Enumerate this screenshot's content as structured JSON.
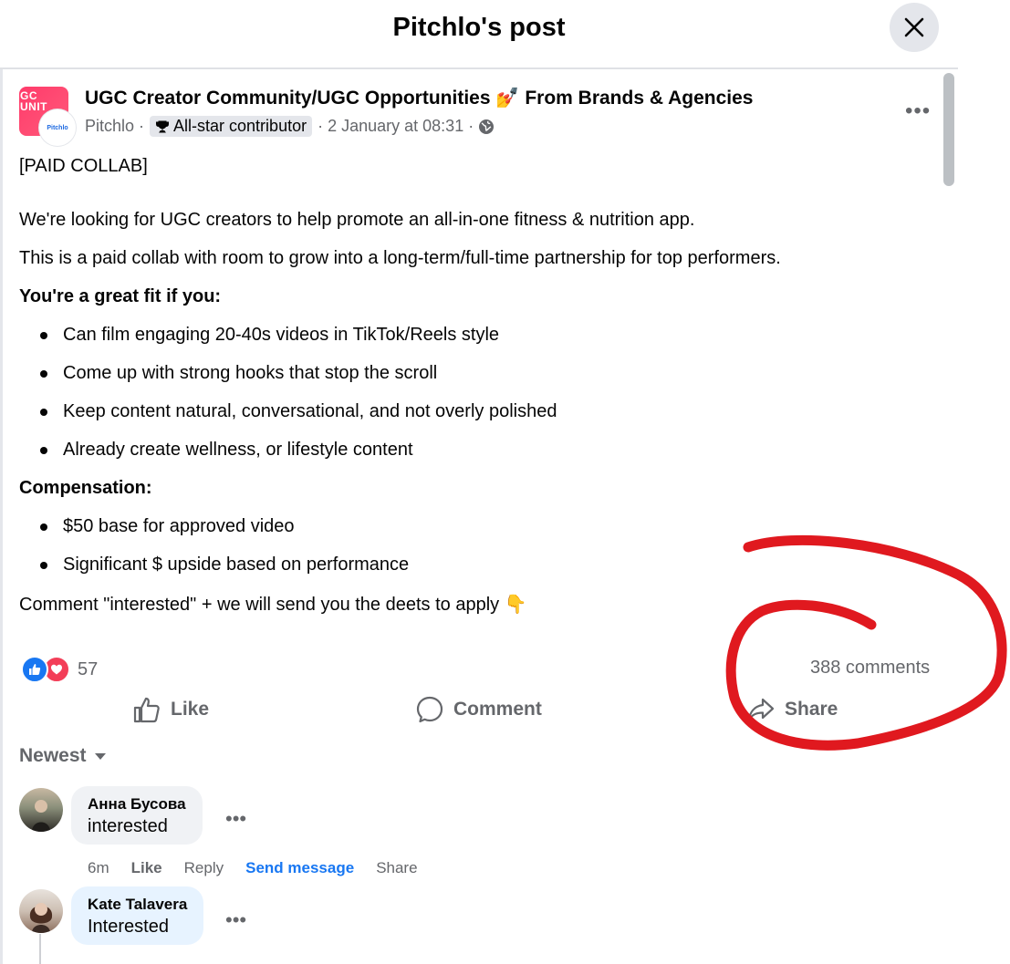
{
  "header": {
    "title": "Pitchlo's post"
  },
  "post": {
    "group_name": "UGC Creator Community/UGC Opportunities 💅 From Brands & Agencies",
    "group_avatar_text": "GC\nUNIT",
    "user_avatar_text": "Pitchlo",
    "author": "Pitchlo",
    "badge": "All-star contributor",
    "timestamp": "2 January at 08:31",
    "lines": [
      "[PAID COLLAB]",
      "We're looking for UGC creators to help promote an all-in-one fitness & nutrition app.",
      "This is a paid collab with room to grow into a long-term/full-time partnership for top performers.",
      "You're a great fit if you:",
      "Compensation:",
      "Comment \"interested\" + we will send you the deets to apply 👇"
    ],
    "fit_bullets": [
      "Can film engaging 20-40s videos in TikTok/Reels style",
      "Come up with strong hooks that stop the scroll",
      "Keep content natural, conversational, and not overly polished",
      "Already create wellness, or lifestyle content"
    ],
    "comp_bullets": [
      "$50 base for approved video",
      "Significant $ upside based on performance"
    ],
    "reaction_count": "57",
    "comments_count": "388 comments"
  },
  "actions": {
    "like": "Like",
    "comment": "Comment",
    "share": "Share"
  },
  "sort": {
    "label": "Newest"
  },
  "comments": [
    {
      "name": "Анна Бусова",
      "text": "interested",
      "time": "6m",
      "like": "Like",
      "reply": "Reply",
      "send": "Send message",
      "share": "Share"
    },
    {
      "name": "Kate Talavera",
      "text": "Interested"
    }
  ],
  "colors": {
    "accent": "#1877f2",
    "annotation": "#e0191f",
    "love": "#f33e58",
    "muted": "#65676b"
  }
}
